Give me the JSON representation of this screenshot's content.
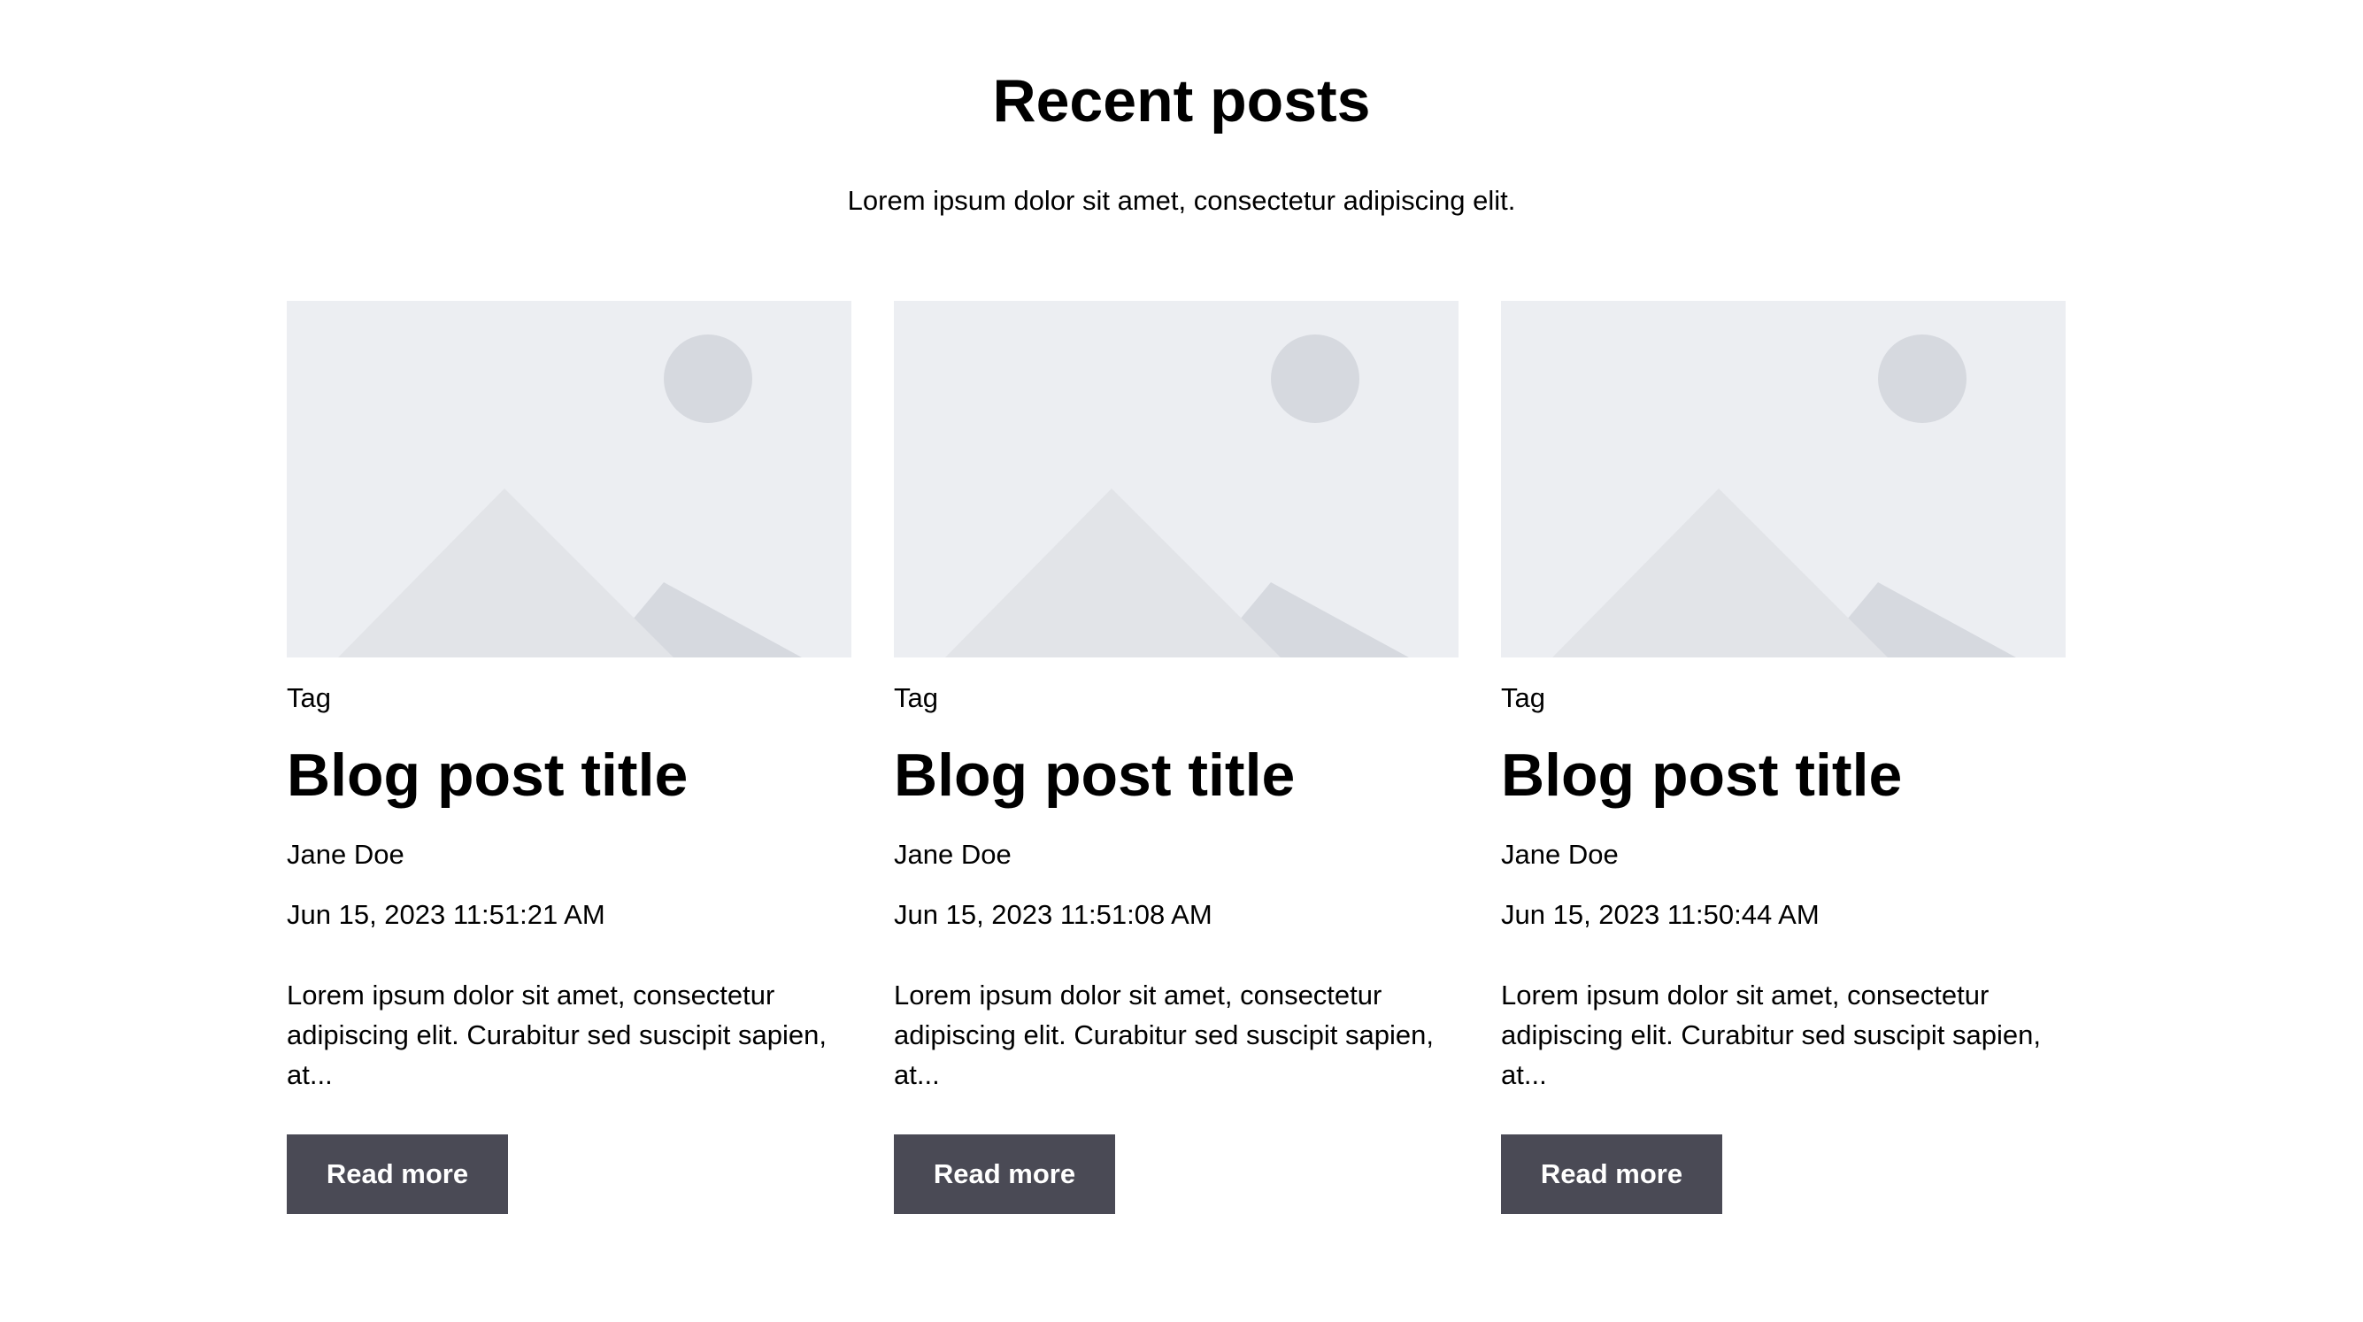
{
  "header": {
    "title": "Recent posts",
    "subtitle": "Lorem ipsum dolor sit amet, consectetur adipiscing elit."
  },
  "colors": {
    "placeholder_bg": "#eceef2",
    "placeholder_mountain_light": "#e2e4e8",
    "placeholder_mountain_dark": "#d6d9df",
    "button_bg": "#4a4a55",
    "button_text": "#ffffff"
  },
  "posts": [
    {
      "image_icon": "image-placeholder-icon",
      "tag": "Tag",
      "title": "Blog post title",
      "author": "Jane Doe",
      "date": "Jun 15, 2023 11:51:21 AM",
      "excerpt": "Lorem ipsum dolor sit amet, consectetur adipiscing elit. Curabitur sed suscipit sapien, at...",
      "button_label": "Read more"
    },
    {
      "image_icon": "image-placeholder-icon",
      "tag": "Tag",
      "title": "Blog post title",
      "author": "Jane Doe",
      "date": "Jun 15, 2023 11:51:08 AM",
      "excerpt": "Lorem ipsum dolor sit amet, consectetur adipiscing elit. Curabitur sed suscipit sapien, at...",
      "button_label": "Read more"
    },
    {
      "image_icon": "image-placeholder-icon",
      "tag": "Tag",
      "title": "Blog post title",
      "author": "Jane Doe",
      "date": "Jun 15, 2023 11:50:44 AM",
      "excerpt": "Lorem ipsum dolor sit amet, consectetur adipiscing elit. Curabitur sed suscipit sapien, at...",
      "button_label": "Read more"
    }
  ]
}
